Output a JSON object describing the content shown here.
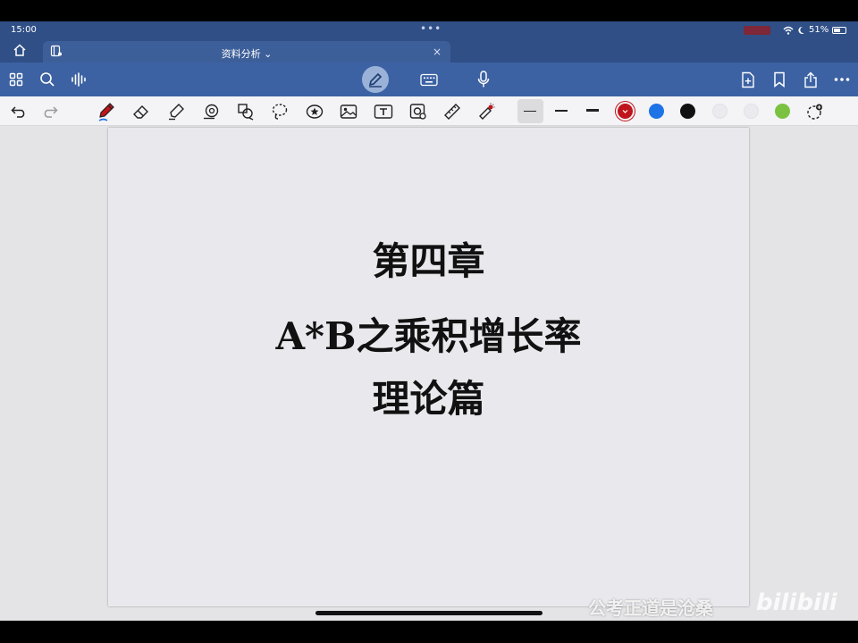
{
  "status_bar": {
    "time": "15:00",
    "dots": "•••",
    "battery_text": "51%"
  },
  "tab_bar": {
    "tab_title": "资料分析 ⌄",
    "close_glyph": "×"
  },
  "main_toolbar": {
    "left_icons": [
      "grid-icon",
      "search-icon",
      "audio-icon"
    ],
    "center_icons": [
      "pen-icon",
      "keyboard-icon",
      "microphone-icon"
    ],
    "right_icons": [
      "add-page-icon",
      "bookmark-icon",
      "share-icon",
      "more-icon"
    ]
  },
  "draw_toolbar": {
    "tools": [
      "undo-icon",
      "redo-icon",
      "pen-tool-icon",
      "eraser-icon",
      "highlighter-icon",
      "shape-icon",
      "lasso-shapes-icon",
      "lasso-icon",
      "sticker-icon",
      "image-icon",
      "text-icon",
      "camera-icon",
      "ruler-icon",
      "laser-pointer-icon"
    ],
    "colors": [
      "#c0141c",
      "#1e73e6",
      "#111111",
      "#f0eff2",
      "#f0eff2",
      "#7cc242"
    ]
  },
  "page": {
    "chapter": "第四章",
    "title": "A*B之乘积增长率",
    "subtitle": "理论篇"
  },
  "watermark": {
    "text": "公考正道是沧桑",
    "logo": "bilibili"
  }
}
